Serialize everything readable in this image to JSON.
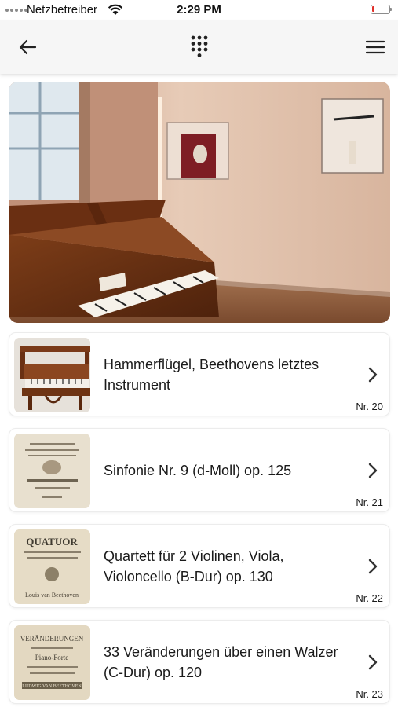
{
  "status_bar": {
    "carrier": "Netzbetreiber",
    "time": "2:29 PM",
    "battery_level": 0.15
  },
  "nav": {
    "back_icon": "arrow-left-icon",
    "center_icon": "keypad-icon",
    "menu_icon": "hamburger-menu-icon"
  },
  "hero": {
    "icon": "photo",
    "colors": {
      "wall": "#d8b49c",
      "piano": "#6b3415",
      "floor": "#8c5a3c"
    }
  },
  "items": [
    {
      "title": "Hammerflügel, Beethovens letztes Instrument",
      "number": "Nr. 20",
      "thumbnail": "fortepiano-photo"
    },
    {
      "title": "Sinfonie Nr. 9 (d-Moll) op. 125",
      "number": "Nr. 21",
      "thumbnail": "score-title-page"
    },
    {
      "title": "Quartett für 2 Violinen, Viola, Violoncello (B-Dur) op. 130",
      "number": "Nr. 22",
      "thumbnail": "score-title-page"
    },
    {
      "title": "33 Veränderungen über einen Walzer (C-Dur) op. 120",
      "number": "Nr. 23",
      "thumbnail": "score-title-page"
    }
  ],
  "thumb_text": {
    "quatuor": "QUATUOR",
    "beethoven": "Louis van Beethoven",
    "veraenderungen": "VERÄNDERUNGEN",
    "piano_forte": "Piano-Forte",
    "beethoven_caps": "LUDWIG VAN BEETHOVEN"
  }
}
